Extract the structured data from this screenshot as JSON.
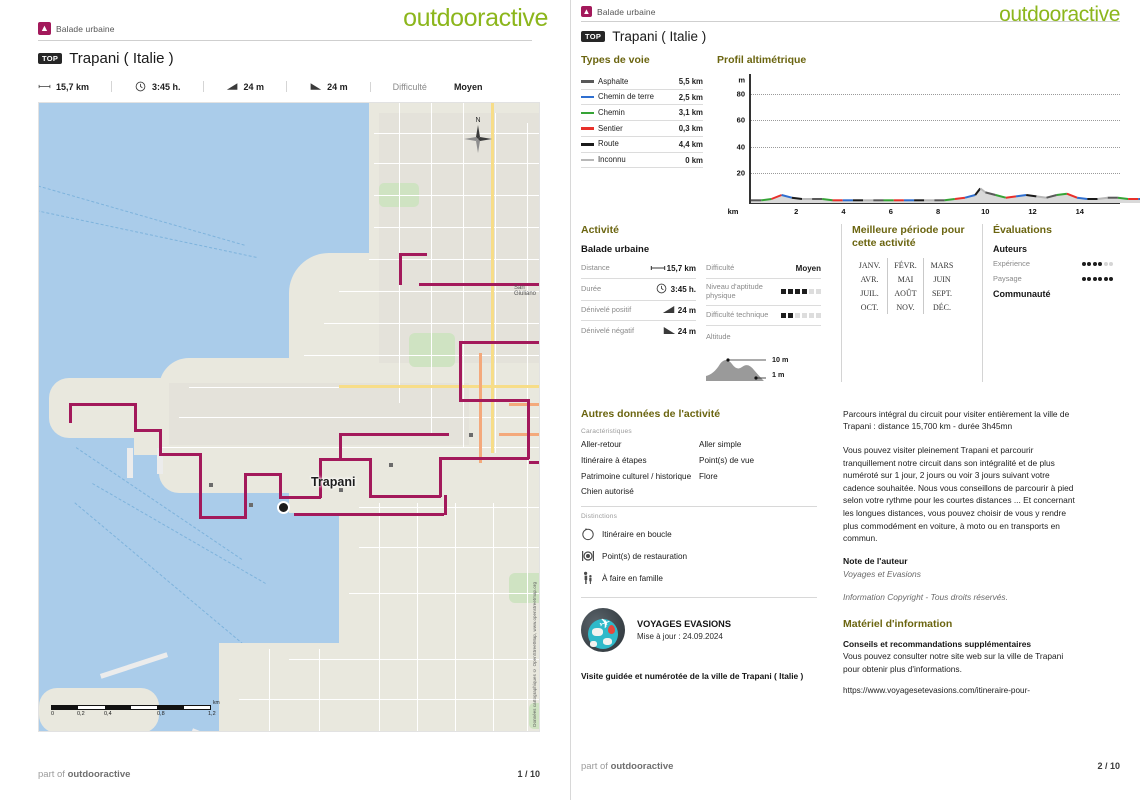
{
  "brand": "outdooractive",
  "footer": {
    "part_of_prefix": "part of ",
    "part_of_brand": "outdooractive"
  },
  "left_page": {
    "category_badge_icon": "hiker-icon",
    "category_label": "Balade urbaine",
    "top_badge": "TOP",
    "title": "Trapani ( Italie )",
    "stats": [
      {
        "icon": "distance-icon",
        "label": "",
        "value": "15,7 km"
      },
      {
        "icon": "clock-icon",
        "label": "",
        "value": "3:45 h."
      },
      {
        "icon": "ascent-icon",
        "label": "",
        "value": "24 m"
      },
      {
        "icon": "descent-icon",
        "label": "",
        "value": "24 m"
      },
      {
        "icon": "",
        "label": "Difficulté",
        "value": "Moyen"
      }
    ],
    "map": {
      "city_label": "Trapani",
      "compass_label": "N",
      "scale_unit": "km",
      "scale_ticks": [
        "0",
        "0,2",
        "0,4",
        "0,8",
        "1,2"
      ],
      "attribution": "Données cartographiques © OpenStreetMap, www.openstreetmap.org"
    },
    "page_number": "1 / 10"
  },
  "right_page": {
    "category_label": "Balade urbaine",
    "top_badge": "TOP",
    "title": "Trapani ( Italie )",
    "way_types": {
      "title": "Types de voie",
      "rows": [
        {
          "name": "Asphalte",
          "distance": "5,5 km",
          "color": "#595959"
        },
        {
          "name": "Chemin de terre",
          "distance": "2,5 km",
          "color": "#2f6fd0"
        },
        {
          "name": "Chemin",
          "distance": "3,1 km",
          "color": "#36a436"
        },
        {
          "name": "Sentier",
          "distance": "0,3 km",
          "color": "#e8302a"
        },
        {
          "name": "Route",
          "distance": "4,4 km",
          "color": "#1a1a1a"
        },
        {
          "name": "Inconnu",
          "distance": "0 km",
          "color": "#b8b8b8"
        }
      ]
    },
    "elevation": {
      "title": "Profil altimétrique"
    },
    "activity": {
      "title": "Activité",
      "subtitle": "Balade urbaine",
      "rows": [
        {
          "label": "Distance",
          "icon": "distance-icon",
          "value": "15,7 km"
        },
        {
          "label": "Durée",
          "icon": "clock-icon",
          "value": "3:45 h."
        },
        {
          "label": "Dénivelé positif",
          "icon": "ascent-icon",
          "value": "24 m"
        },
        {
          "label": "Dénivelé négatif",
          "icon": "descent-icon",
          "value": "24 m"
        }
      ],
      "difficulty_label": "Difficulté",
      "difficulty_value": "Moyen",
      "fitness_label": "Niveau d'aptitude physique",
      "fitness_filled": 4,
      "fitness_total": 6,
      "technique_label": "Difficulté technique",
      "technique_filled": 2,
      "technique_total": 6,
      "altitude_label": "Altitude",
      "altitude_max": "10 m",
      "altitude_min": "1 m"
    },
    "best_period": {
      "title": "Meilleure période pour cette activité",
      "months": [
        "JANV.",
        "FÉVR.",
        "MARS",
        "AVR.",
        "MAI",
        "JUIN",
        "JUIL.",
        "AOÛT",
        "SEPT.",
        "OCT.",
        "NOV.",
        "DÉC."
      ]
    },
    "evaluations": {
      "title": "Évaluations",
      "authors_heading": "Auteurs",
      "rows": [
        {
          "label": "Expérience",
          "filled": 4,
          "total": 6
        },
        {
          "label": "Paysage",
          "filled": 6,
          "total": 6
        }
      ],
      "community_heading": "Communauté"
    },
    "other_data": {
      "title": "Autres données de l'activité",
      "characteristics_label": "Caractéristiques",
      "characteristics": [
        "Aller-retour",
        "Aller simple",
        "Itinéraire à étapes",
        "Point(s) de vue",
        "Patrimoine culturel / historique",
        "Flore",
        "Chien autorisé",
        ""
      ],
      "distinctions_label": "Distinctions",
      "distinctions": [
        {
          "icon": "loop-route-icon",
          "label": "Itinéraire en boucle"
        },
        {
          "icon": "restaurant-icon",
          "label": "Point(s) de restauration"
        },
        {
          "icon": "family-icon",
          "label": "À faire en famille"
        }
      ]
    },
    "author": {
      "logo_icon": "globe-plane-icon",
      "name": "VOYAGES EVASIONS",
      "updated": "Mise à jour : 24.09.2024",
      "description": "Visite guidée et numérotée de la ville de Trapani ( Italie )"
    },
    "description": {
      "paragraph1": "Parcours intégral du circuit pour visiter entièrement la ville de Trapani : distance 15,700 km - durée 3h45mn",
      "paragraph2": "Vous pouvez visiter pleinement Trapani et parcourir tranquillement notre circuit dans son intégralité et de plus numéroté sur 1 jour, 2 jours ou voir 3 jours suivant votre cadence souhaitée. Nous vous conseillons de parcourir à pied selon votre rythme pour les courtes distances ... Et concernant les longues distances, vous pouvez choisir de vous y rendre plus commodément en voiture, à moto ou en transports en commun."
    },
    "author_note": {
      "heading": "Note de l'auteur",
      "value": "Voyages et Evasions",
      "copyright": "Information Copyright - Tous droits réservés."
    },
    "material": {
      "title": "Matériel d'information",
      "tip_heading": "Conseils et recommandations supplémentaires",
      "tip_body": "Vous pouvez consulter notre site web sur la ville de Trapani pour obtenir plus d'informations.",
      "url": "https://www.voyagesetevasions.com/itineraire-pour-"
    },
    "page_number": "2 / 10"
  },
  "chart_data": {
    "type": "area",
    "title": "Profil altimétrique",
    "xlabel": "km",
    "ylabel": "m",
    "ylim": [
      0,
      95
    ],
    "yticks": [
      20,
      40,
      60,
      80
    ],
    "xlim": [
      0,
      15.7
    ],
    "xticks": [
      2,
      4,
      6,
      8,
      10,
      12,
      14
    ],
    "grid": true,
    "x": [
      0,
      0.4,
      0.8,
      1.2,
      1.6,
      2.0,
      2.4,
      2.8,
      3.2,
      3.6,
      4.0,
      4.4,
      4.8,
      5.2,
      5.6,
      6.0,
      6.4,
      6.8,
      7.2,
      7.6,
      8.0,
      8.4,
      8.8,
      9.0,
      9.2,
      9.6,
      10.0,
      10.4,
      10.8,
      11.2,
      11.6,
      12.0,
      12.4,
      12.8,
      13.2,
      13.6,
      14.0,
      14.4,
      14.8,
      15.2,
      15.7
    ],
    "y": [
      2,
      2,
      3,
      6,
      4,
      3,
      3,
      3,
      2,
      2,
      2,
      2,
      2,
      2,
      2,
      2,
      2,
      2,
      2,
      2,
      3,
      4,
      6,
      11,
      8,
      6,
      4,
      5,
      6,
      5,
      4,
      6,
      7,
      4,
      3,
      3,
      4,
      4,
      3,
      3,
      3
    ],
    "segment_colors": [
      "#595959",
      "#36a436",
      "#e8302a",
      "#2f6fd0",
      "#1a1a1a",
      "#b8b8b8"
    ],
    "fill_color": "#d9d9d9"
  }
}
